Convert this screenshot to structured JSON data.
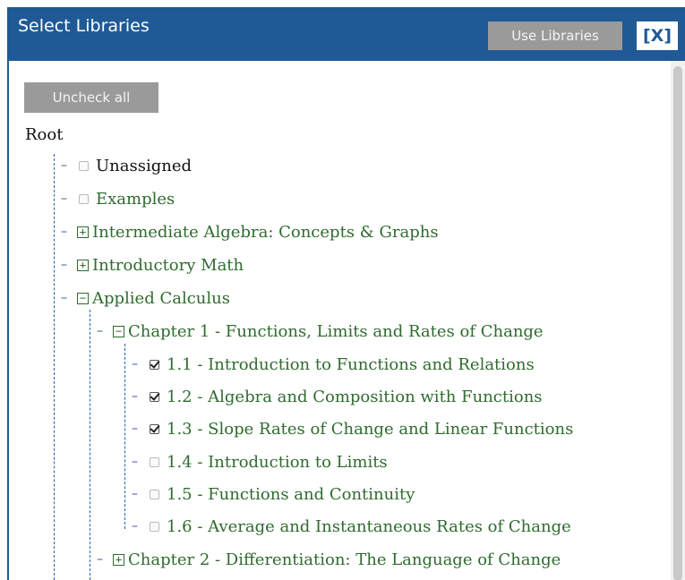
{
  "dialog": {
    "title": "Select Libraries",
    "use_button": "Use Libraries",
    "close_button": "[X]"
  },
  "tree": {
    "uncheck_all": "Uncheck all",
    "root": "Root",
    "items": [
      {
        "label": "Unassigned",
        "control": "checkbox",
        "checked": false
      },
      {
        "label": "Examples",
        "control": "checkbox",
        "checked": false
      },
      {
        "label": "Intermediate Algebra: Concepts & Graphs",
        "control": "expand",
        "symbol": "+"
      },
      {
        "label": "Introductory Math",
        "control": "expand",
        "symbol": "+"
      },
      {
        "label": "Applied Calculus",
        "control": "collapse",
        "symbol": "−"
      },
      {
        "label": "Chapter 1 - Functions, Limits and Rates of Change",
        "control": "collapse",
        "symbol": "−"
      },
      {
        "label": "1.1 - Introduction to Functions and Relations",
        "control": "checkbox",
        "checked": true
      },
      {
        "label": "1.2 - Algebra and Composition with Functions",
        "control": "checkbox",
        "checked": true
      },
      {
        "label": "1.3 - Slope Rates of Change and Linear Functions",
        "control": "checkbox",
        "checked": true
      },
      {
        "label": "1.4 - Introduction to Limits",
        "control": "checkbox",
        "checked": false
      },
      {
        "label": "1.5 - Functions and Continuity",
        "control": "checkbox",
        "checked": false
      },
      {
        "label": "1.6 - Average and Instantaneous Rates of Change",
        "control": "checkbox",
        "checked": false
      },
      {
        "label": "Chapter 2 - Differentiation: The Language of Change",
        "control": "expand",
        "symbol": "+"
      }
    ]
  },
  "colors": {
    "header": "#1f5a96",
    "button": "#9a9a9a",
    "tree_text": "#2f6b2f",
    "tree_lines": "#2a5fa8"
  }
}
